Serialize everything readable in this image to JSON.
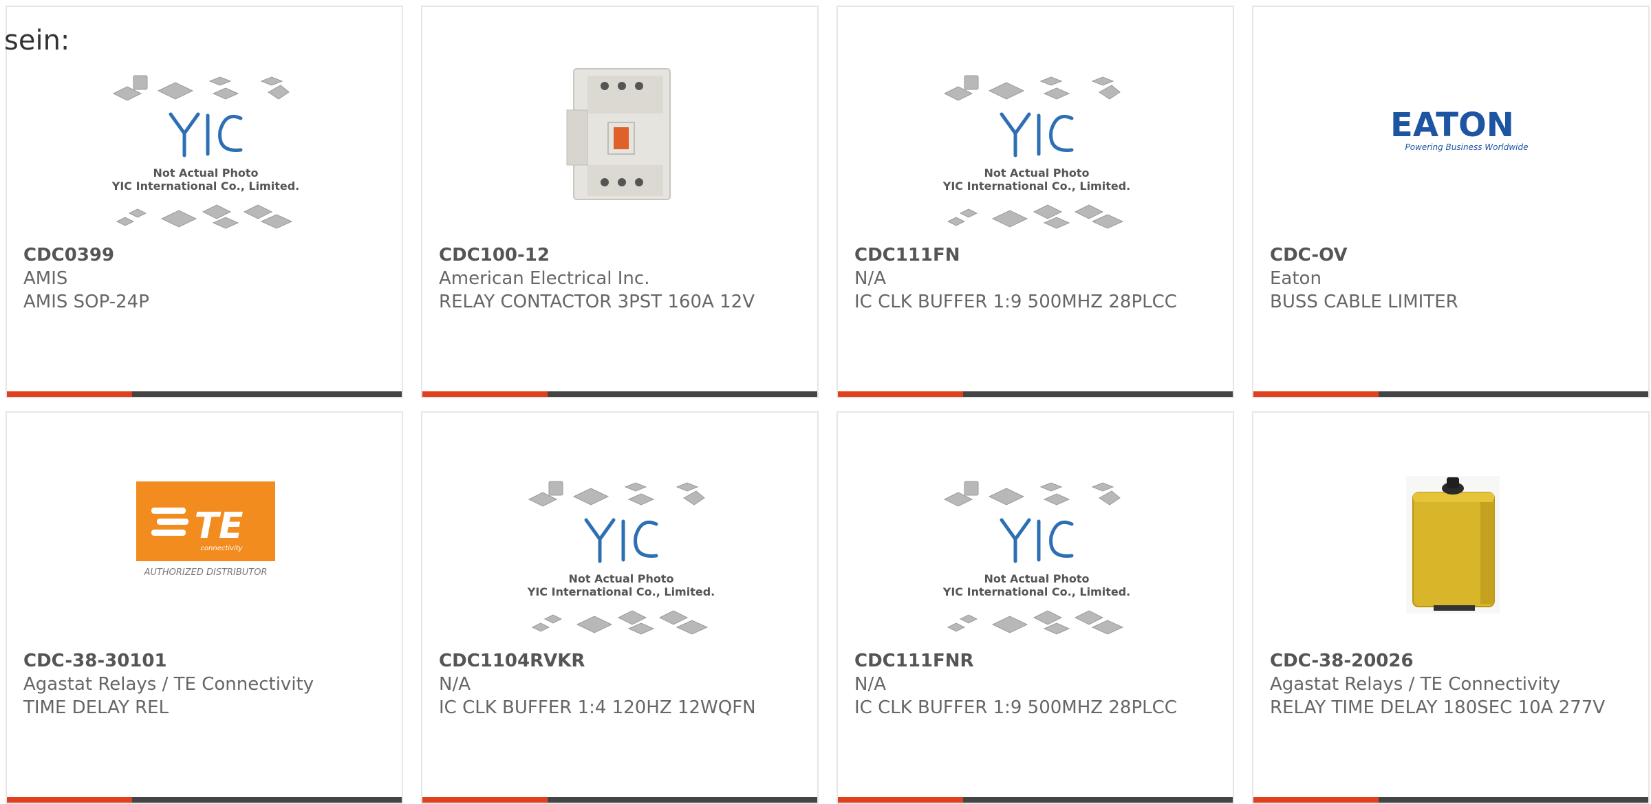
{
  "lead_text": "sein:",
  "accent_color": "#e0401e",
  "bar_color": "#444444",
  "placeholder_text": {
    "line1": "Not Actual Photo",
    "line2": "YIC International Co., Limited."
  },
  "eaton_logo": {
    "name": "EATON",
    "tagline": "Powering Business Worldwide"
  },
  "te_logo": {
    "name": "TE",
    "sub": "connectivity",
    "footer": "AUTHORIZED DISTRIBUTOR"
  },
  "products": [
    {
      "part_number": "CDC0399",
      "manufacturer": "AMIS",
      "description": "AMIS SOP-24P",
      "image": "yic-placeholder"
    },
    {
      "part_number": "CDC100-12",
      "manufacturer": "American Electrical Inc.",
      "description": "RELAY CONTACTOR 3PST 160A 12V",
      "image": "contactor-photo"
    },
    {
      "part_number": "CDC111FN",
      "manufacturer": "N/A",
      "description": "IC CLK BUFFER 1:9 500MHZ 28PLCC",
      "image": "yic-placeholder"
    },
    {
      "part_number": "CDC-OV",
      "manufacturer": "Eaton",
      "description": "BUSS CABLE LIMITER",
      "image": "eaton-logo"
    },
    {
      "part_number": "CDC-38-30101",
      "manufacturer": "Agastat Relays / TE Connectivity",
      "description": "TIME DELAY REL",
      "image": "te-logo"
    },
    {
      "part_number": "CDC1104RVKR",
      "manufacturer": "N/A",
      "description": "IC CLK BUFFER 1:4 120HZ 12WQFN",
      "image": "yic-placeholder"
    },
    {
      "part_number": "CDC111FNR",
      "manufacturer": "N/A",
      "description": "IC CLK BUFFER 1:9 500MHZ 28PLCC",
      "image": "yic-placeholder"
    },
    {
      "part_number": "CDC-38-20026",
      "manufacturer": "Agastat Relays / TE Connectivity",
      "description": "RELAY TIME DELAY 180SEC 10A 277V",
      "image": "relay-photo"
    }
  ]
}
